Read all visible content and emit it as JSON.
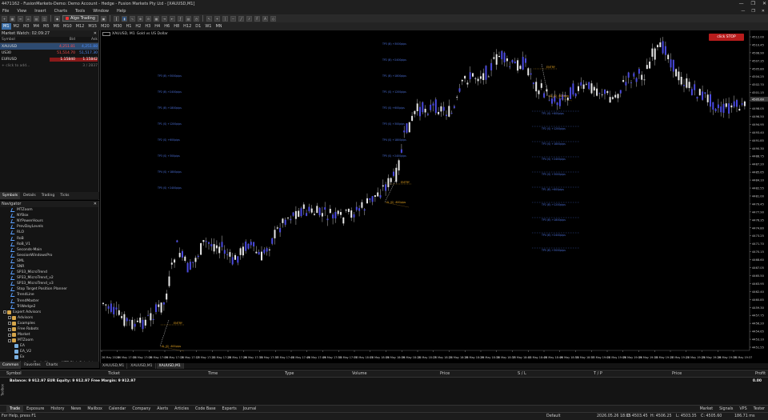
{
  "window": {
    "title": "4471162 - FusionMarkets-Demo: Demo Account - Hedge - Fusion Markets Pty Ltd - [XAUUSD,M1]",
    "controls": [
      "—",
      "❐",
      "✕"
    ]
  },
  "menu": {
    "items": [
      "File",
      "View",
      "Insert",
      "Charts",
      "Tools",
      "Window",
      "Help"
    ],
    "right": [
      "—",
      "❐",
      "✕"
    ]
  },
  "toolbar": {
    "algo_label": "Algo Trading"
  },
  "timeframes": [
    "M1",
    "M2",
    "M3",
    "M4",
    "M5",
    "M6",
    "M10",
    "M12",
    "M15",
    "M20",
    "M30",
    "H1",
    "H2",
    "H3",
    "H4",
    "H6",
    "H8",
    "H12",
    "D1",
    "W1",
    "MN"
  ],
  "active_timeframe": "M1",
  "market_watch": {
    "title": "Market Watch: 02:09:27",
    "headers": [
      "Symbol",
      "Bid",
      "Ask"
    ],
    "rows": [
      {
        "symbol": "XAUUSD",
        "bid": "4,251.81",
        "ask": "4,251.88"
      },
      {
        "symbol": "US30",
        "bid": "51,514.70",
        "ask": "51,517.30"
      },
      {
        "symbol": "EURUSD",
        "bid": "1.15840",
        "ask": "1.15842"
      }
    ],
    "add_hint": "+ click to add...",
    "counter": "3 / 2837",
    "tabs": [
      "Symbols",
      "Details",
      "Trading",
      "Ticks"
    ]
  },
  "navigator": {
    "title": "Navigator",
    "items": [
      {
        "label": "MTZoom",
        "type": "ind"
      },
      {
        "label": "NYBox",
        "type": "ind"
      },
      {
        "label": "NYPowerHours",
        "type": "ind"
      },
      {
        "label": "PrevDayLevels",
        "type": "ind"
      },
      {
        "label": "RLO",
        "type": "ind"
      },
      {
        "label": "RoB",
        "type": "ind"
      },
      {
        "label": "RoB_V1",
        "type": "ind"
      },
      {
        "label": "Seconds-Main",
        "type": "ind"
      },
      {
        "label": "SessionWindowsPro",
        "type": "ind"
      },
      {
        "label": "SML",
        "type": "ind"
      },
      {
        "label": "SNR",
        "type": "ind"
      },
      {
        "label": "SP33_MicroTrend",
        "type": "ind"
      },
      {
        "label": "SP33_MicroTrend_v2",
        "type": "ind"
      },
      {
        "label": "SP33_MicroTrend_v3",
        "type": "ind"
      },
      {
        "label": "Stop Target Position Planner",
        "type": "ind"
      },
      {
        "label": "TrendLine",
        "type": "ind"
      },
      {
        "label": "TrendMaster",
        "type": "ind"
      },
      {
        "label": "TriWedge2",
        "type": "ind"
      },
      {
        "label": "Expert Advisors",
        "type": "root"
      },
      {
        "label": "Advisors",
        "type": "folder"
      },
      {
        "label": "Examples",
        "type": "folder"
      },
      {
        "label": "Free Robots",
        "type": "folder"
      },
      {
        "label": "Market",
        "type": "folder"
      },
      {
        "label": "MTZoom",
        "type": "folder"
      },
      {
        "label": "EA",
        "type": "ea"
      },
      {
        "label": "EA_V2",
        "type": "ea"
      },
      {
        "label": "Ex",
        "type": "ea"
      },
      {
        "label": "Lotsize Trade Manager MT5 Risk Calculator",
        "type": "ea"
      }
    ],
    "tabs": [
      "Common",
      "Favorites",
      "Charts"
    ]
  },
  "chart": {
    "symbol_label": "XAUUSD, M1",
    "description": "Gold vs US Dollar",
    "stop_button": "click STOP",
    "tabs": [
      "XAUUSD,M1",
      "XAUUSD,M1",
      "XAUUSD,M1"
    ],
    "active_tab": 2,
    "tick_labels_x": [
      "26 May 2026",
      "26 May 17:01",
      "26 May 17:05",
      "26 May 17:09",
      "26 May 17:13",
      "26 May 17:17",
      "26 May 17:21",
      "26 May 17:25",
      "26 May 17:29",
      "26 May 17:33",
      "26 May 17:37",
      "26 May 17:41",
      "26 May 17:45",
      "26 May 17:49",
      "26 May 17:53",
      "26 May 17:57",
      "26 May 18:01",
      "26 May 18:05",
      "26 May 18:09",
      "26 May 18:13",
      "26 May 18:17",
      "26 May 18:21",
      "26 May 18:25",
      "26 May 18:29",
      "26 May 18:33",
      "26 May 18:37",
      "26 May 18:41",
      "26 May 18:45",
      "26 May 18:49",
      "26 May 18:53",
      "26 May 18:57",
      "26 May 19:01",
      "26 May 19:05",
      "26 May 19:09",
      "26 May 19:13",
      "26 May 19:17",
      "26 May 19:21",
      "26 May 19:25",
      "26 May 19:29",
      "26 May 19:33",
      "26 May 19:37"
    ],
    "price_labels": [
      "4512.00",
      "4510.45",
      "4508.90",
      "4507.35",
      "4505.80",
      "4504.25",
      "4502.70",
      "4501.15",
      "4499.60",
      "4498.05",
      "4496.50",
      "4494.95",
      "4493.40",
      "4491.85",
      "4490.30",
      "4488.75",
      "4487.20",
      "4485.65",
      "4484.10",
      "4482.55",
      "4481.00",
      "4479.45",
      "4477.90",
      "4476.35",
      "4474.80",
      "4473.25",
      "4471.70",
      "4470.15",
      "4468.60",
      "4467.05",
      "4465.50",
      "4463.95",
      "4462.40",
      "4460.85",
      "4459.30",
      "4457.75",
      "4456.20",
      "4454.65",
      "4453.10",
      "4451.55"
    ],
    "current_price_label": "4505.60",
    "colors": {
      "bull": "#4a4adf",
      "bear": "#e8e8e8",
      "wick": "#cfcfcf",
      "level": "#4b6fd8",
      "fib": "#e0a020",
      "axis": "#ccc",
      "stop": "#b71c1c"
    },
    "levels_group1": [
      "TP3 (B) +3000pips",
      "TP2 (B) +2400pips",
      "TP1 (B) +1800pips",
      "TP1 (S) +1200pips",
      "TP2 (S) +600pips",
      "TP3 (S) +300pips",
      "TP4 (S) +1800pips",
      "TP5 (S) +2400pips"
    ],
    "levels_group2": [
      "TP3 (B) +3000pips",
      "TP2 (B) +2400pips",
      "TP1 (B) +1800pips",
      "TP1 (S) +1200pips",
      "TP2 (S) +600pips",
      "TP3 (S) +300pips",
      "TP4 (S) +1800pips",
      "TP5 (S) +2400pips"
    ],
    "levels_group3": [
      "TP1 (S) +600pips",
      "TP2 (S) +1200pips",
      "TP3 (S) +1800pips",
      "TP4 (S) +2400pips",
      "TP5 (S) +3000pips",
      "TP1 (B) +600pips",
      "TP2 (B) +1200pips",
      "TP3 (B) +1800pips",
      "TP4 (B) +2400pips",
      "TP5 (B) +3000pips"
    ],
    "fib_labels": [
      "ENTRY",
      "SL (S) -600pips",
      "ENTRY",
      "SL (S) -600pips",
      "ENTRY",
      "SL (S) -600pips"
    ]
  },
  "terminal": {
    "headers": [
      "Symbol",
      "Ticket",
      "Time",
      "Type",
      "Volume",
      "Price",
      "S / L",
      "T / P",
      "Price",
      "Profit"
    ],
    "balance_line": "Balance: 9 912.97 EUR  Equity: 9 912.97  Free Margin: 9 912.97",
    "profit_total": "0.00",
    "tabs": [
      "Trade",
      "Exposure",
      "History",
      "News",
      "Mailbox",
      "Calendar",
      "Company",
      "Alerts",
      "Articles",
      "Code Base",
      "Experts",
      "Journal"
    ],
    "right_items": [
      "Market",
      "Signals",
      "VPS",
      "Tester"
    ],
    "toolbox": "Toolbox"
  },
  "status": {
    "help": "For Help, press F1",
    "profile": "Default",
    "datetime": "2026.05.26 18:15",
    "open": "O: 4503.45",
    "high": "H: 4506.25",
    "low": "L: 4503.35",
    "close": "C: 4505.60",
    "traffic": "186.71 ms"
  }
}
